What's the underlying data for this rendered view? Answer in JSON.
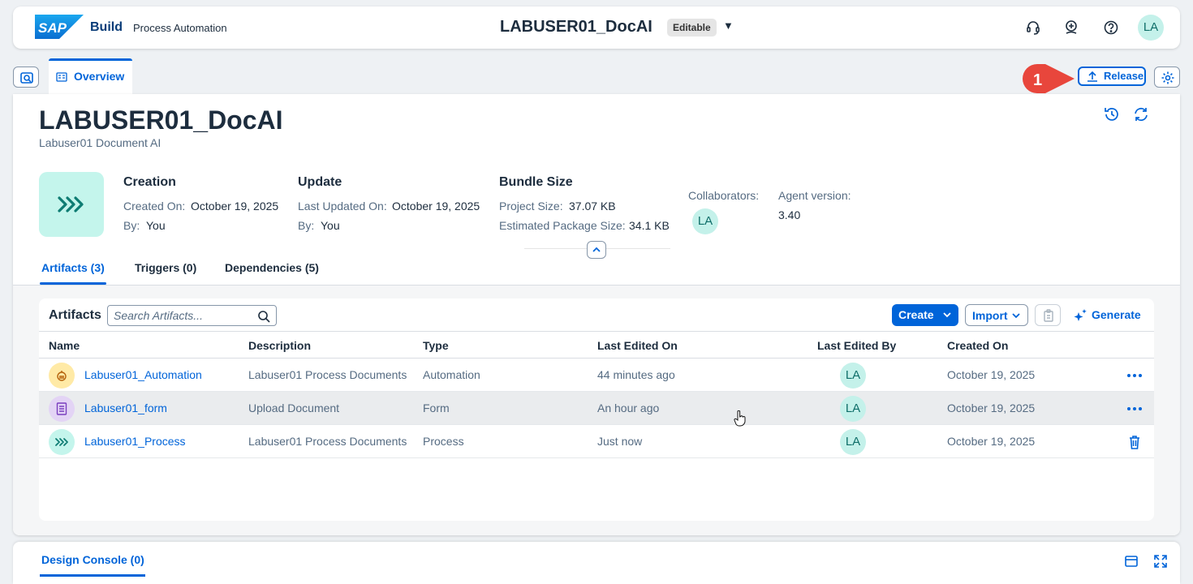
{
  "shell": {
    "logo_text": "SAP",
    "brand": "Build",
    "product": "Process Automation",
    "project_title": "LABUSER01_DocAI",
    "editable_badge": "Editable",
    "user_initials": "LA"
  },
  "tabs_bar": {
    "overview_label": "Overview",
    "callout_number": "1",
    "release_label": "Release"
  },
  "header": {
    "title": "LABUSER01_DocAI",
    "subtitle": "Labuser01 Document AI"
  },
  "creation": {
    "heading": "Creation",
    "created_on_label": "Created On:",
    "created_on_value": "October 19, 2025",
    "by_label": "By:",
    "by_value": "You"
  },
  "update": {
    "heading": "Update",
    "last_updated_label": "Last Updated On:",
    "last_updated_value": "October 19, 2025",
    "by_label": "By:",
    "by_value": "You"
  },
  "bundle": {
    "heading": "Bundle Size",
    "project_size_label": "Project Size:",
    "project_size_value": "37.07 KB",
    "package_size_label": "Estimated Package Size:",
    "package_size_value": "34.1 KB"
  },
  "collaborators": {
    "label": "Collaborators:",
    "initials": "LA"
  },
  "agent": {
    "label": "Agent version:",
    "value": "3.40"
  },
  "content_tabs": {
    "artifacts": "Artifacts (3)",
    "triggers": "Triggers (0)",
    "dependencies": "Dependencies (5)"
  },
  "artifacts": {
    "title": "Artifacts",
    "search_placeholder": "Search Artifacts...",
    "create_label": "Create",
    "import_label": "Import",
    "generate_label": "Generate",
    "columns": {
      "name": "Name",
      "description": "Description",
      "type": "Type",
      "last_edited_on": "Last Edited On",
      "last_edited_by": "Last Edited By",
      "created_on": "Created On"
    },
    "rows": [
      {
        "name": "Labuser01_Automation",
        "description": "Labuser01 Process Documents",
        "type": "Automation",
        "last_edited_on": "44 minutes ago",
        "last_edited_by": "LA",
        "created_on": "October 19, 2025"
      },
      {
        "name": "Labuser01_form",
        "description": "Upload Document",
        "type": "Form",
        "last_edited_on": "An hour ago",
        "last_edited_by": "LA",
        "created_on": "October 19, 2025"
      },
      {
        "name": "Labuser01_Process",
        "description": "Labuser01 Process Documents",
        "type": "Process",
        "last_edited_on": "Just now",
        "last_edited_by": "LA",
        "created_on": "October 19, 2025"
      }
    ]
  },
  "console": {
    "label": "Design Console (0)"
  },
  "colors": {
    "accent": "#0064d9",
    "brand_blue": "#0a3c78",
    "callout": "#e8463c",
    "avatar_bg": "#c4f1ea"
  },
  "icons": [
    "search-icon",
    "headset-icon",
    "feedback-icon",
    "help-icon",
    "history-icon",
    "refresh-icon",
    "settings-icon",
    "upload-icon",
    "process-icon",
    "automation-icon",
    "form-icon",
    "paste-icon",
    "sparkle-icon",
    "more-icon",
    "delete-icon",
    "panel-icon",
    "fullscreen-icon"
  ]
}
